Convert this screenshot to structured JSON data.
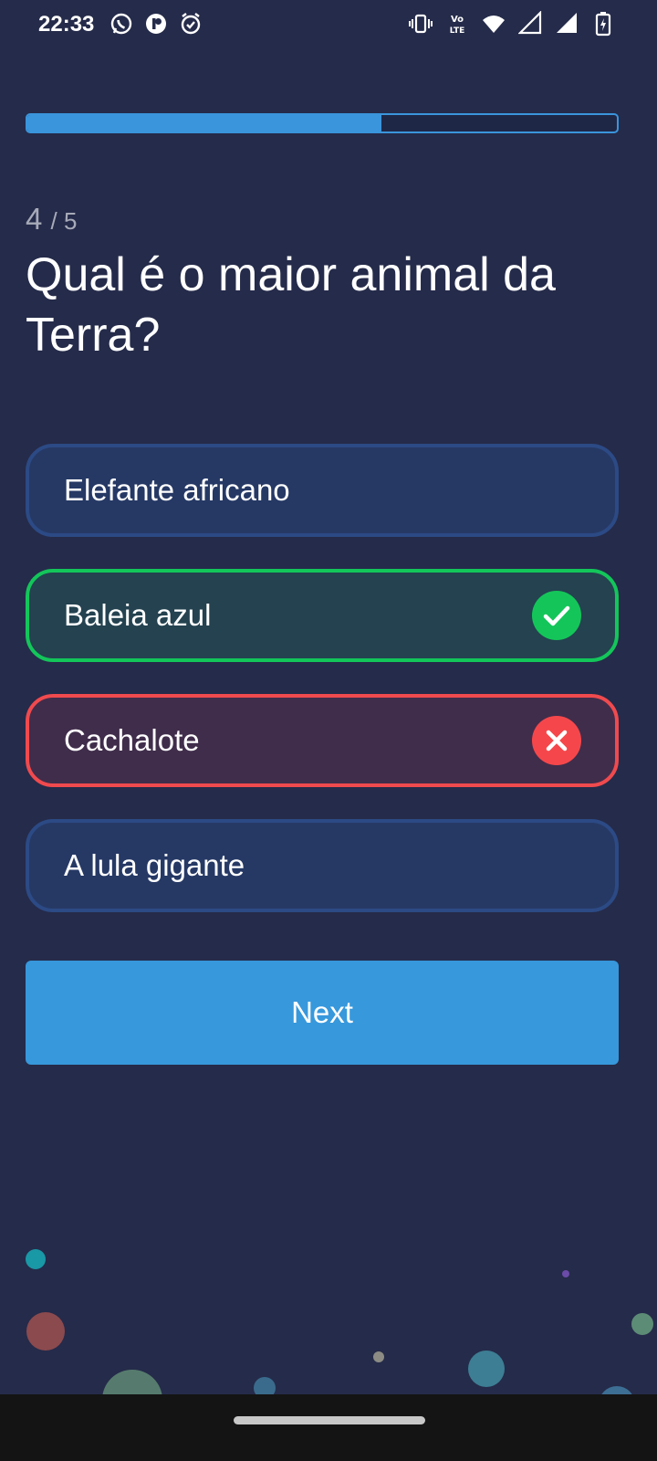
{
  "status_bar": {
    "time": "22:33",
    "left_icons": [
      "whatsapp-icon",
      "app-icon",
      "alarm-icon"
    ],
    "right_icons": [
      "vibrate-icon",
      "volte-icon",
      "wifi-icon",
      "signal-icon",
      "signal-icon-2",
      "battery-charging-icon"
    ]
  },
  "quiz": {
    "progress_percent": 60,
    "current": "4",
    "total": "/ 5",
    "question": "Qual é o maior animal da Terra?",
    "options": [
      {
        "label": "Elefante africano",
        "state": "neutral"
      },
      {
        "label": "Baleia azul",
        "state": "correct"
      },
      {
        "label": "Cachalote",
        "state": "wrong"
      },
      {
        "label": "A lula gigante",
        "state": "neutral"
      }
    ],
    "next_label": "Next"
  },
  "colors": {
    "background": "#252b4a",
    "accent": "#3798dc",
    "correct": "#13c65a",
    "wrong": "#f04a4e"
  }
}
